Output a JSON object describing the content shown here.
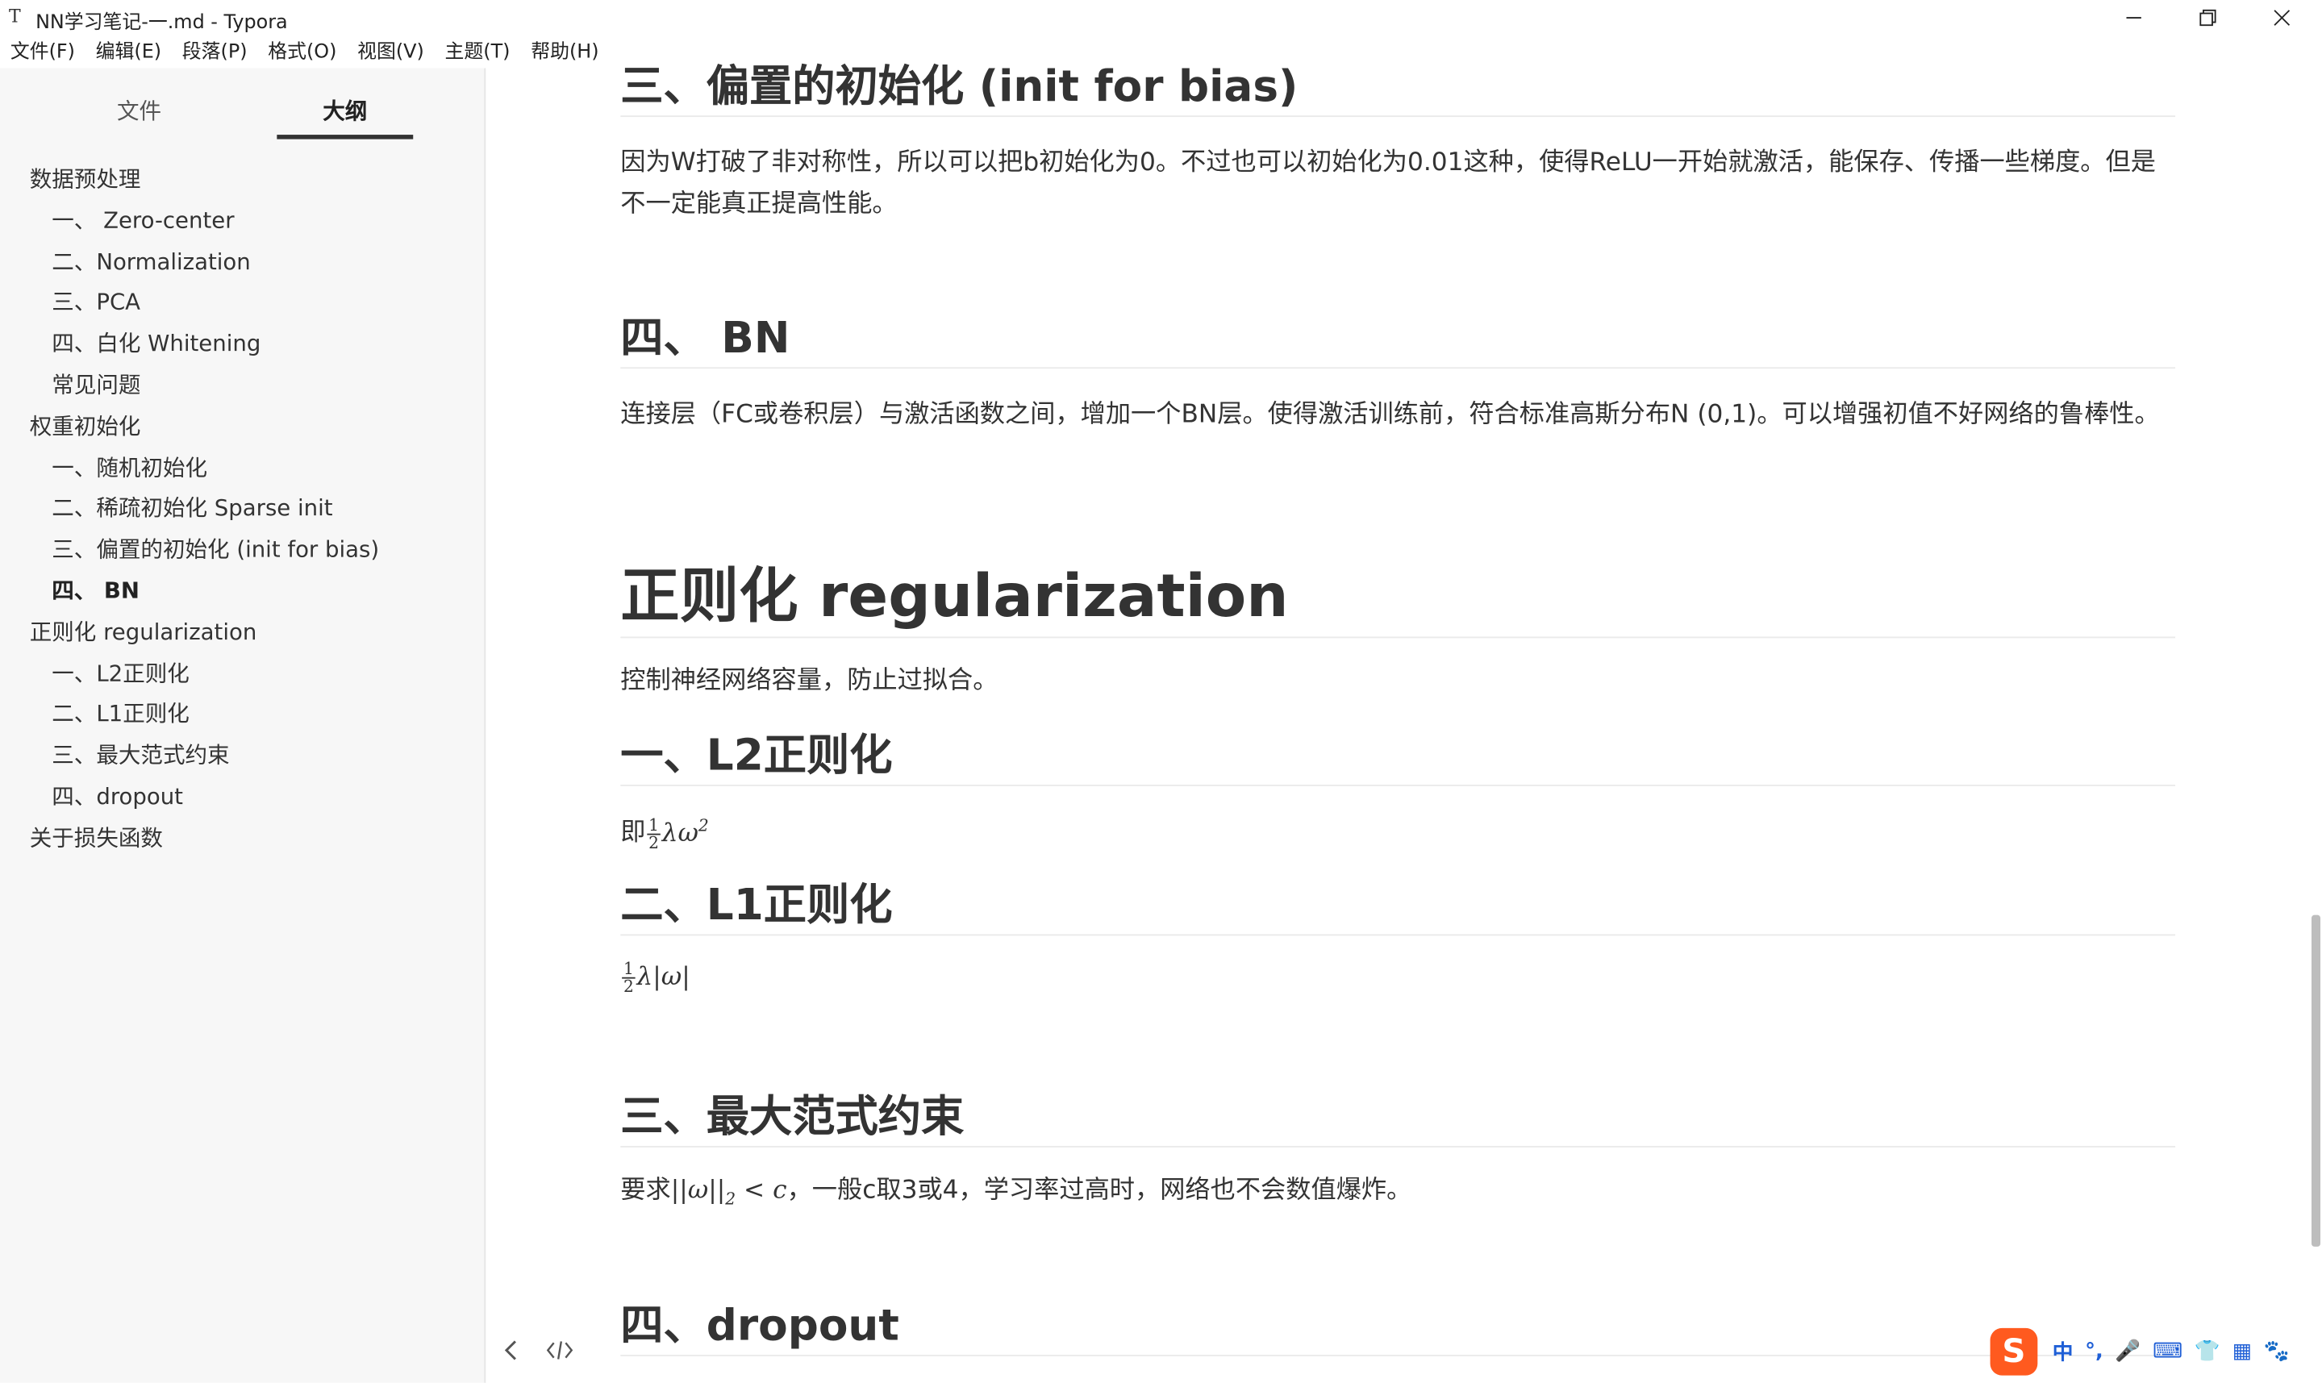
{
  "window": {
    "app_icon": "T",
    "title": "NN学习笔记-一.md - Typora"
  },
  "menu": [
    "文件(F)",
    "编辑(E)",
    "段落(P)",
    "格式(O)",
    "视图(V)",
    "主题(T)",
    "帮助(H)"
  ],
  "sidebar": {
    "tabs": [
      "文件",
      "大纲"
    ],
    "active_tab": "大纲",
    "outline": [
      {
        "label": "数据预处理",
        "level": 1
      },
      {
        "label": "一、 Zero-center",
        "level": 2
      },
      {
        "label": "二、Normalization",
        "level": 2
      },
      {
        "label": "三、PCA",
        "level": 2
      },
      {
        "label": "四、白化 Whitening",
        "level": 2
      },
      {
        "label": "常见问题",
        "level": 2
      },
      {
        "label": "权重初始化",
        "level": 1
      },
      {
        "label": "一、随机初始化",
        "level": 2
      },
      {
        "label": "二、稀疏初始化 Sparse init",
        "level": 2
      },
      {
        "label": "三、偏置的初始化 (init for bias)",
        "level": 2
      },
      {
        "label": "四、 BN",
        "level": 2,
        "active": true
      },
      {
        "label": "正则化 regularization",
        "level": 1
      },
      {
        "label": "一、L2正则化",
        "level": 2
      },
      {
        "label": "二、L1正则化",
        "level": 2
      },
      {
        "label": "三、最大范式约束",
        "level": 2
      },
      {
        "label": "四、dropout",
        "level": 2
      },
      {
        "label": "关于损失函数",
        "level": 1
      }
    ],
    "footer_icons": [
      "chevron-left-icon",
      "source-code-icon"
    ]
  },
  "editor": {
    "bias_heading": "三、偏置的初始化 (init for bias)",
    "bias_text": "因为W打破了非对称性，所以可以把b初始化为0。不过也可以初始化为0.01这种，使得ReLU一开始就激活，能保存、传播一些梯度。但是不一定能真正提高性能。",
    "bn_heading": "四、 BN",
    "bn_text": "连接层（FC或卷积层）与激活函数之间，增加一个BN层。使得激活训练前，符合标准高斯分布N (0,1)。可以增强初值不好网络的鲁棒性。",
    "reg_heading": "正则化 regularization",
    "reg_text": "控制神经网络容量，防止过拟合。",
    "l2_heading": "一、L2正则化",
    "l2_prefix": "即",
    "l2_frac_num": "1",
    "l2_frac_den": "2",
    "l2_expr": "λω",
    "l2_sup": "2",
    "l1_heading": "二、L1正则化",
    "l1_frac_num": "1",
    "l1_frac_den": "2",
    "l1_expr": "λ|ω|",
    "maxnorm_heading": "三、最大范式约束",
    "maxnorm_prefix": "要求",
    "maxnorm_expr": "||ω||",
    "maxnorm_sub": "2",
    "maxnorm_lt": " < c",
    "maxnorm_suffix": "，一般c取3或4，学习率过高时，网络也不会数值爆炸。",
    "dropout_heading": "四、dropout"
  },
  "ime": {
    "logo": "S",
    "items": [
      "中",
      "°,",
      "🎤",
      "⌨",
      "👕",
      "▦",
      "🐾"
    ]
  }
}
